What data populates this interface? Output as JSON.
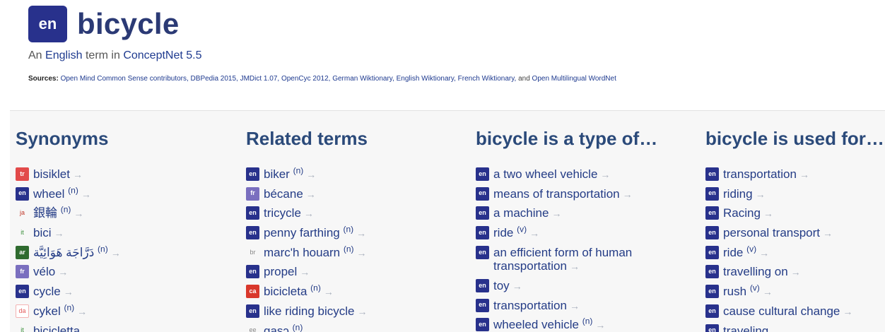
{
  "colors": {
    "en": "#28318c",
    "tr": "#e24a4a",
    "ar": "#2f6b2f",
    "fr": "#7a6fbf",
    "ca": "#d9382c",
    "da": "#e8a0a0"
  },
  "header": {
    "badge": "en",
    "title": "bicycle",
    "subtitle_prefix": "An",
    "subtitle_lang": "English",
    "subtitle_mid": "term in",
    "subtitle_source": "ConceptNet 5.5",
    "sources_label": "Sources:",
    "sources_text": "Open Mind Common Sense contributors, DBPedia 2015, JMDict 1.07, OpenCyc 2012, German Wiktionary, English Wiktionary, French Wiktionary,",
    "sources_and": "and",
    "sources_last": "Open Multilingual WordNet"
  },
  "arrow": "→",
  "columns": [
    {
      "title": "Synonyms",
      "items": [
        {
          "lang": "tr",
          "text": "bisiklet",
          "pos": ""
        },
        {
          "lang": "en",
          "text": "wheel",
          "pos": "(n)"
        },
        {
          "lang": "ja",
          "text": "銀輪",
          "pos": "(n)"
        },
        {
          "lang": "it",
          "text": "bici",
          "pos": ""
        },
        {
          "lang": "ar",
          "text": "دَرَّاجَة هَوَائِيَّة",
          "pos": "(n)"
        },
        {
          "lang": "fr",
          "text": "vélo",
          "pos": ""
        },
        {
          "lang": "en",
          "text": "cycle",
          "pos": ""
        },
        {
          "lang": "da",
          "text": "cykel",
          "pos": "(n)"
        },
        {
          "lang": "it",
          "text": "bicicletta",
          "pos": ""
        }
      ]
    },
    {
      "title": "Related terms",
      "items": [
        {
          "lang": "en",
          "text": "biker",
          "pos": "(n)"
        },
        {
          "lang": "fr",
          "text": "bécane",
          "pos": ""
        },
        {
          "lang": "en",
          "text": "tricycle",
          "pos": ""
        },
        {
          "lang": "en",
          "text": "penny farthing",
          "pos": "(n)"
        },
        {
          "lang": "br",
          "text": "marc'h houarn",
          "pos": "(n)"
        },
        {
          "lang": "en",
          "text": "propel",
          "pos": ""
        },
        {
          "lang": "ca",
          "text": "bicicleta",
          "pos": "(n)"
        },
        {
          "lang": "en",
          "text": "like riding bicycle",
          "pos": ""
        },
        {
          "lang": "ee",
          "text": "gasɔ",
          "pos": "(n)"
        }
      ]
    },
    {
      "title": "bicycle is a type of…",
      "items": [
        {
          "lang": "en",
          "text": "a two wheel vehicle",
          "pos": ""
        },
        {
          "lang": "en",
          "text": "means of transportation",
          "pos": ""
        },
        {
          "lang": "en",
          "text": "a machine",
          "pos": ""
        },
        {
          "lang": "en",
          "text": "ride",
          "pos": "(v)"
        },
        {
          "lang": "en",
          "text": "an efficient form of human transportation",
          "pos": ""
        },
        {
          "lang": "en",
          "text": "toy",
          "pos": ""
        },
        {
          "lang": "en",
          "text": "transportation",
          "pos": ""
        },
        {
          "lang": "en",
          "text": "wheeled vehicle",
          "pos": "(n)"
        }
      ]
    },
    {
      "title": "bicycle is used for…",
      "items": [
        {
          "lang": "en",
          "text": "transportation",
          "pos": ""
        },
        {
          "lang": "en",
          "text": "riding",
          "pos": ""
        },
        {
          "lang": "en",
          "text": "Racing",
          "pos": ""
        },
        {
          "lang": "en",
          "text": "personal transport",
          "pos": ""
        },
        {
          "lang": "en",
          "text": "ride",
          "pos": "(v)"
        },
        {
          "lang": "en",
          "text": "travelling on",
          "pos": ""
        },
        {
          "lang": "en",
          "text": "rush",
          "pos": "(v)"
        },
        {
          "lang": "en",
          "text": "cause cultural change",
          "pos": ""
        },
        {
          "lang": "en",
          "text": "traveling",
          "pos": ""
        }
      ]
    }
  ]
}
